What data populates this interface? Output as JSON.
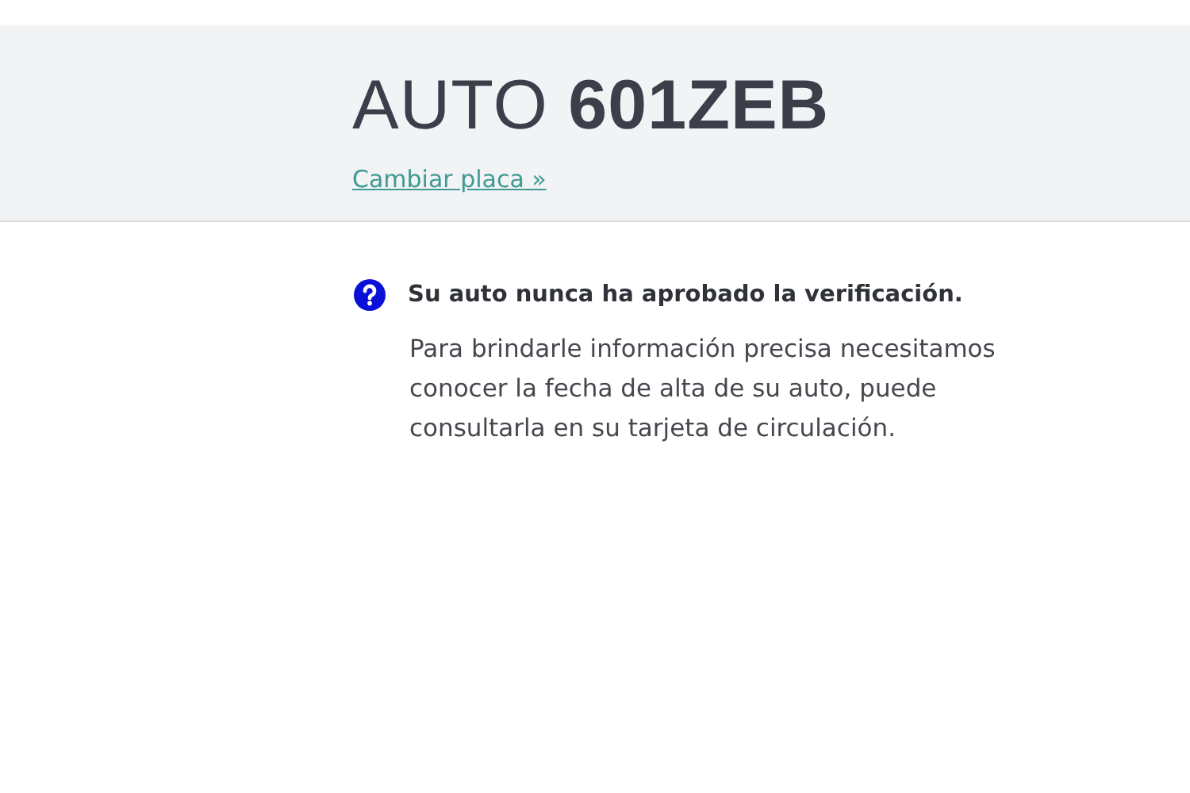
{
  "header": {
    "title": "AUTO **601ZEB**",
    "link": "Cambiar placa »"
  },
  "notice": {
    "kind": "question",
    "heading": "Su auto nunca ha aprobado la verificación.",
    "text": "Para brindarle información precisa necesitamos conocer la fecha de alta de su auto, puede consultarla en su tarjeta de circulación."
  }
}
